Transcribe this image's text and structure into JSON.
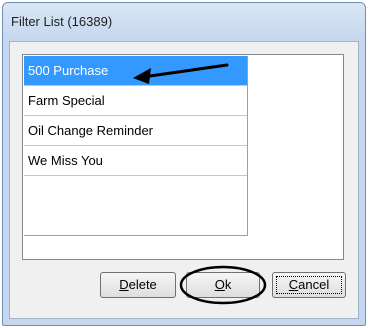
{
  "window": {
    "title": "Filter List (16389)"
  },
  "list": {
    "items": [
      {
        "label": "500 Purchase",
        "selected": true
      },
      {
        "label": "Farm Special",
        "selected": false
      },
      {
        "label": "Oil Change Reminder",
        "selected": false
      },
      {
        "label": "We Miss You",
        "selected": false
      }
    ]
  },
  "buttons": {
    "delete": {
      "mnemonic": "D",
      "rest": "elete"
    },
    "ok": {
      "mnemonic": "O",
      "rest": "k"
    },
    "cancel": {
      "mnemonic": "C",
      "rest": "ancel"
    }
  },
  "annotations": {
    "arrow_icon": "arrow-left-icon",
    "highlight_icon": "circle-highlight-icon"
  },
  "colors": {
    "selection": "#3399ff",
    "title_bar": "#c5d7ee"
  }
}
